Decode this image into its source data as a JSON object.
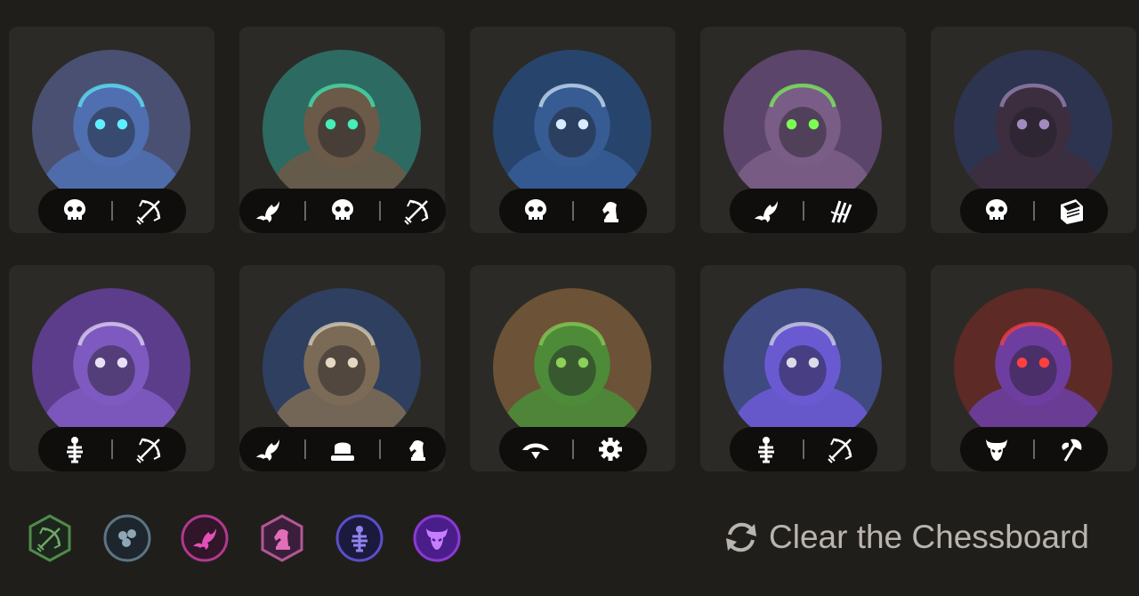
{
  "board": {
    "cards": [
      {
        "name": "hooded-assassin",
        "bg": "#4a5072",
        "fg": "#4f6fb0",
        "accent": "#5ff0ff",
        "traits": [
          "skull",
          "bow"
        ]
      },
      {
        "name": "treant-shaman",
        "bg": "#2d6a62",
        "fg": "#6b5a48",
        "accent": "#42f0b8",
        "traits": [
          "bat",
          "skull",
          "bow"
        ]
      },
      {
        "name": "skull-mage",
        "bg": "#27446d",
        "fg": "#365c93",
        "accent": "#d8ecff",
        "traits": [
          "skull",
          "knight"
        ]
      },
      {
        "name": "horned-dragon",
        "bg": "#5b456a",
        "fg": "#7a5d86",
        "accent": "#7aff52",
        "traits": [
          "bat",
          "claws"
        ]
      },
      {
        "name": "dark-rogue",
        "bg": "#2d3450",
        "fg": "#3d2e3f",
        "accent": "#a38bc0",
        "traits": [
          "skull",
          "book"
        ]
      },
      {
        "name": "purple-sorceress",
        "bg": "#5c3d8b",
        "fg": "#7e5ac0",
        "accent": "#e9e0f7",
        "traits": [
          "fishbone",
          "bow"
        ]
      },
      {
        "name": "skeleton-warrior",
        "bg": "#2f3f60",
        "fg": "#7b6a55",
        "accent": "#e4d8c0",
        "traits": [
          "bat",
          "hat",
          "knight"
        ]
      },
      {
        "name": "goblin-engineer",
        "bg": "#6c5236",
        "fg": "#4d8b39",
        "accent": "#8bd059",
        "traits": [
          "goggles",
          "gear"
        ]
      },
      {
        "name": "old-hag",
        "bg": "#3e4a80",
        "fg": "#6a5ad2",
        "accent": "#dadce6",
        "traits": [
          "fishbone",
          "bow"
        ]
      },
      {
        "name": "masked-ninja",
        "bg": "#5d2a26",
        "fg": "#6d3ea0",
        "accent": "#ff4040",
        "traits": [
          "demon",
          "axe"
        ]
      }
    ]
  },
  "synergies": [
    {
      "name": "synergy-ranger",
      "border": "#4f8a4a",
      "fill": "#1c261c",
      "icon": "bow",
      "color": "#6fa868",
      "shape": "hex"
    },
    {
      "name": "synergy-scaled",
      "border": "#5c7584",
      "fill": "#1c262c",
      "icon": "scales",
      "color": "#8fa6b4",
      "shape": "circle"
    },
    {
      "name": "synergy-bat",
      "border": "#b2398f",
      "fill": "#301628",
      "icon": "bat",
      "color": "#e251b5",
      "shape": "circle"
    },
    {
      "name": "synergy-knight",
      "border": "#b15796",
      "fill": "#3a1e3a",
      "icon": "knight",
      "color": "#e06fb8",
      "shape": "hex"
    },
    {
      "name": "synergy-fishbone",
      "border": "#5a4fcc",
      "fill": "#1c1a3c",
      "icon": "fishbone",
      "color": "#8f84f0",
      "shape": "circle"
    },
    {
      "name": "synergy-demon",
      "border": "#8a3ad0",
      "fill": "#4a1e8a",
      "icon": "demon",
      "color": "#c77dff",
      "shape": "circle"
    }
  ],
  "clear_button": {
    "label": "Clear the Chessboard"
  }
}
